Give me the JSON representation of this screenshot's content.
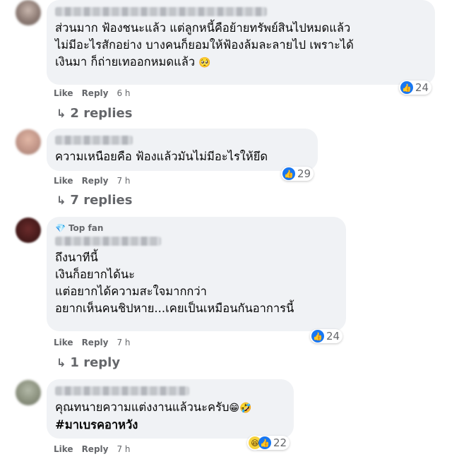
{
  "comments": [
    {
      "text": "ส่วนมาก ฟ้องชนะแล้ว แต่ลูกหนี้คือย้ายทรัพย์สินไปหมดแล้ว\nไม่มีอะไรสักอย่าง บางคนก็ยอมให้ฟ้องล้มละลายไป เพราะได้\nเงินมา ก็ถ่ายเทออกหมดแล้ว",
      "emoji": "🥺",
      "like": "Like",
      "reply": "Reply",
      "time": "6 h",
      "reactions": "24",
      "replies": "2 replies"
    },
    {
      "text": "ความเหนือยคือ ฟ้องแล้วมันไม่มีอะไรให้ยึด",
      "like": "Like",
      "reply": "Reply",
      "time": "7 h",
      "reactions": "29",
      "replies": "7 replies"
    },
    {
      "badge": "Top fan",
      "text": "ถึงนาทีนี้\nเงินก็อยากได้นะ\nแต่อยากได้ความสะใจมากกว่า\nอยากเห็นคนชิปหาย...เคยเป็นเหมือนกันอาการนี้",
      "like": "Like",
      "reply": "Reply",
      "time": "7 h",
      "reactions": "24",
      "replies": "1 reply"
    },
    {
      "text": "คุณทนายความแต่งงานแล้วนะครับ",
      "emoji": "😁🤣",
      "hashtag": "#มาเบรคอาหวัง",
      "like": "Like",
      "reply": "Reply",
      "time": "7 h",
      "reactions": "22"
    }
  ],
  "icons": {
    "like": "thumbs-up-icon",
    "haha": "laughing-face-icon",
    "reply_arrow": "reply-arrow-icon",
    "top_fan": "diamond-icon"
  },
  "colors": {
    "bubble": "#f0f2f5",
    "meta": "#65676b",
    "like_blue": "#1877f2"
  }
}
